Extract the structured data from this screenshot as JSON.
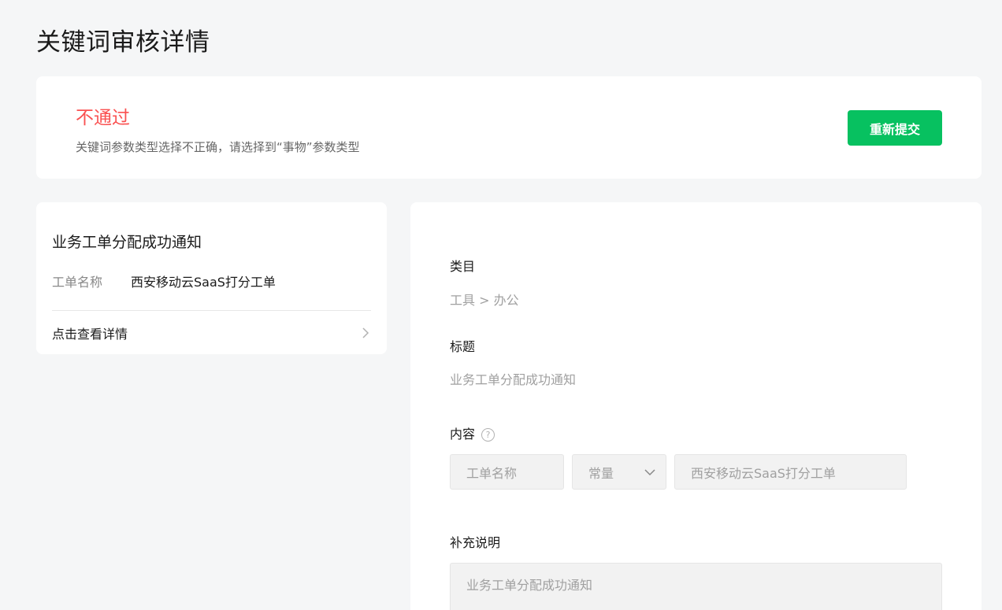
{
  "page": {
    "title": "关键词审核详情"
  },
  "status": {
    "title": "不通过",
    "description": "关键词参数类型选择不正确，请选择到“事物”参数类型",
    "resubmit_label": "重新提交",
    "title_color": "#fa5151",
    "button_color": "#07c160"
  },
  "template": {
    "title": "业务工单分配成功通知",
    "field_label": "工单名称",
    "field_value": "西安移动云SaaS打分工单",
    "view_details_label": "点击查看详情",
    "view_details_icon": "chevron-right-icon"
  },
  "form": {
    "category_label": "类目",
    "category_value": "工具 > 办公",
    "title_label": "标题",
    "title_value": "业务工单分配成功通知",
    "content_label": "内容",
    "content_help_icon": "question-circle-icon",
    "content_help_glyph": "?",
    "param_name": "工单名称",
    "param_type": "常量",
    "param_type_icon": "chevron-down-icon",
    "param_value": "西安移动云SaaS打分工单",
    "supplement_label": "补充说明",
    "supplement_value": "业务工单分配成功通知"
  }
}
